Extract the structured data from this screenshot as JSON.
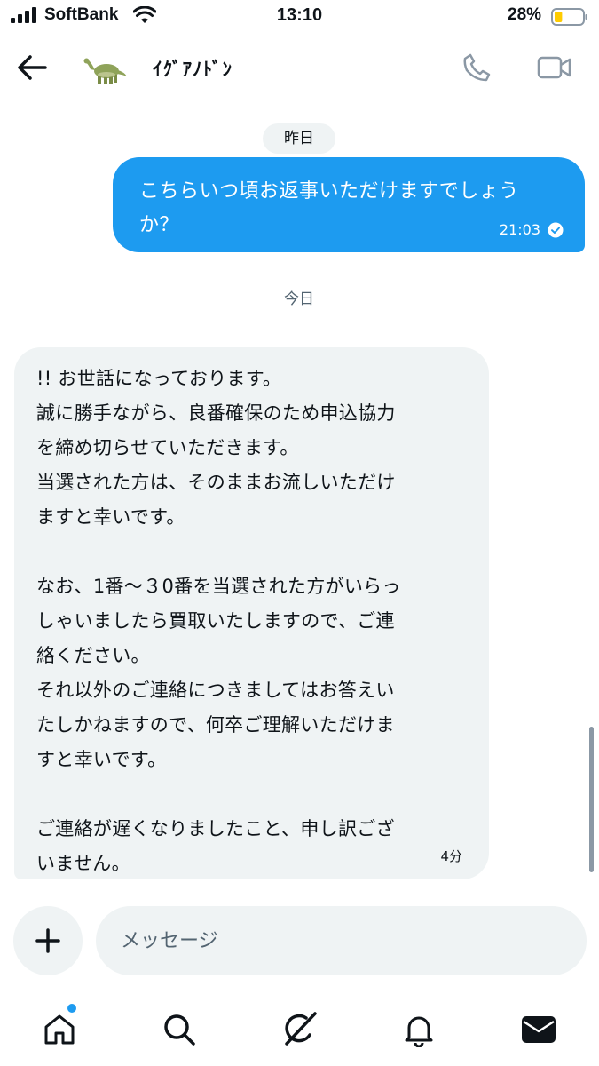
{
  "status_bar": {
    "carrier": "SoftBank",
    "time": "13:10",
    "battery_percent": "28%",
    "battery_level": 0.28
  },
  "header": {
    "contact_name": "ｲｸﾞｱﾉﾄﾞﾝ",
    "back_icon": "arrow-left-icon",
    "call_icon": "phone-icon",
    "video_icon": "video-camera-icon"
  },
  "conversation": {
    "date_yesterday": "昨日",
    "date_today": "今日",
    "sent_message": {
      "lines": [
        "こちらいつ頃お返事いただけますでしょう",
        "か？"
      ],
      "time": "21:03",
      "status_icon": "check-circle-icon"
    },
    "received_message": {
      "lines": [
        "!! お世話になっております。",
        "誠に勝手ながら、良番確保のため申込協力",
        "を締め切らせていただきます。",
        "当選された方は、そのままお流しいただけ",
        "ますと幸いです。",
        "",
        "なお、1番〜３0番を当選された方がいらっ",
        "しゃいましたら買取いたしますので、ご連",
        "絡ください。",
        "それ以外のご連絡につきましてはお答えい",
        "たしかねますので、何卒ご理解いただけま",
        "すと幸いです。",
        "",
        "ご連絡が遅くなりましたこと、申し訳ござ",
        "いません。"
      ],
      "time": "4分"
    }
  },
  "composer": {
    "placeholder": "メッセージ",
    "add_icon": "plus-icon"
  },
  "tabbar": {
    "items": [
      "home-icon",
      "search-icon",
      "grok-icon",
      "bell-icon",
      "mail-icon"
    ]
  },
  "colors": {
    "accent": "#1d9bf0",
    "bubble_in": "#eff3f4",
    "secondary_text": "#536471"
  }
}
